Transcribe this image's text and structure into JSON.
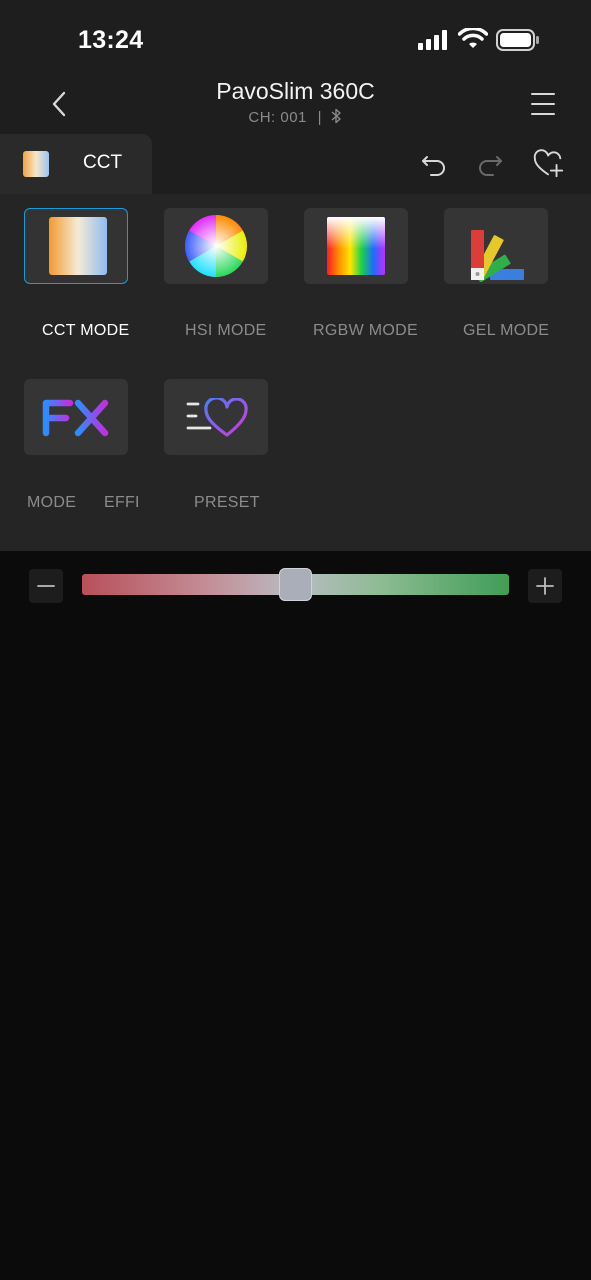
{
  "status_bar": {
    "time": "13:24"
  },
  "header": {
    "title": "PavoSlim 360C",
    "channel": "CH: 001",
    "separator": "|"
  },
  "tab": {
    "active_label": "CCT"
  },
  "modes": [
    {
      "label": "CCT MODE",
      "icon": "cct-icon",
      "selected": true
    },
    {
      "label": "HSI MODE",
      "icon": "hsi-color-wheel-icon",
      "selected": false
    },
    {
      "label": "RGBW MODE",
      "icon": "rgbw-spectrum-icon",
      "selected": false
    },
    {
      "label": "GEL MODE",
      "icon": "gel-swatch-fan-icon",
      "selected": false
    },
    {
      "label_left": "MODE",
      "label_right": "EFFE",
      "icon": "fx-icon",
      "selected": false
    },
    {
      "label": "PRESET",
      "icon": "preset-heart-icon",
      "selected": false
    }
  ],
  "slider": {
    "value_fraction": 0.5,
    "colors": {
      "left": "#b8505a",
      "right": "#3f9d55"
    }
  },
  "colors": {
    "accent": "#1a9bdc",
    "background": "#0b0b0b",
    "panel": "#252525"
  }
}
